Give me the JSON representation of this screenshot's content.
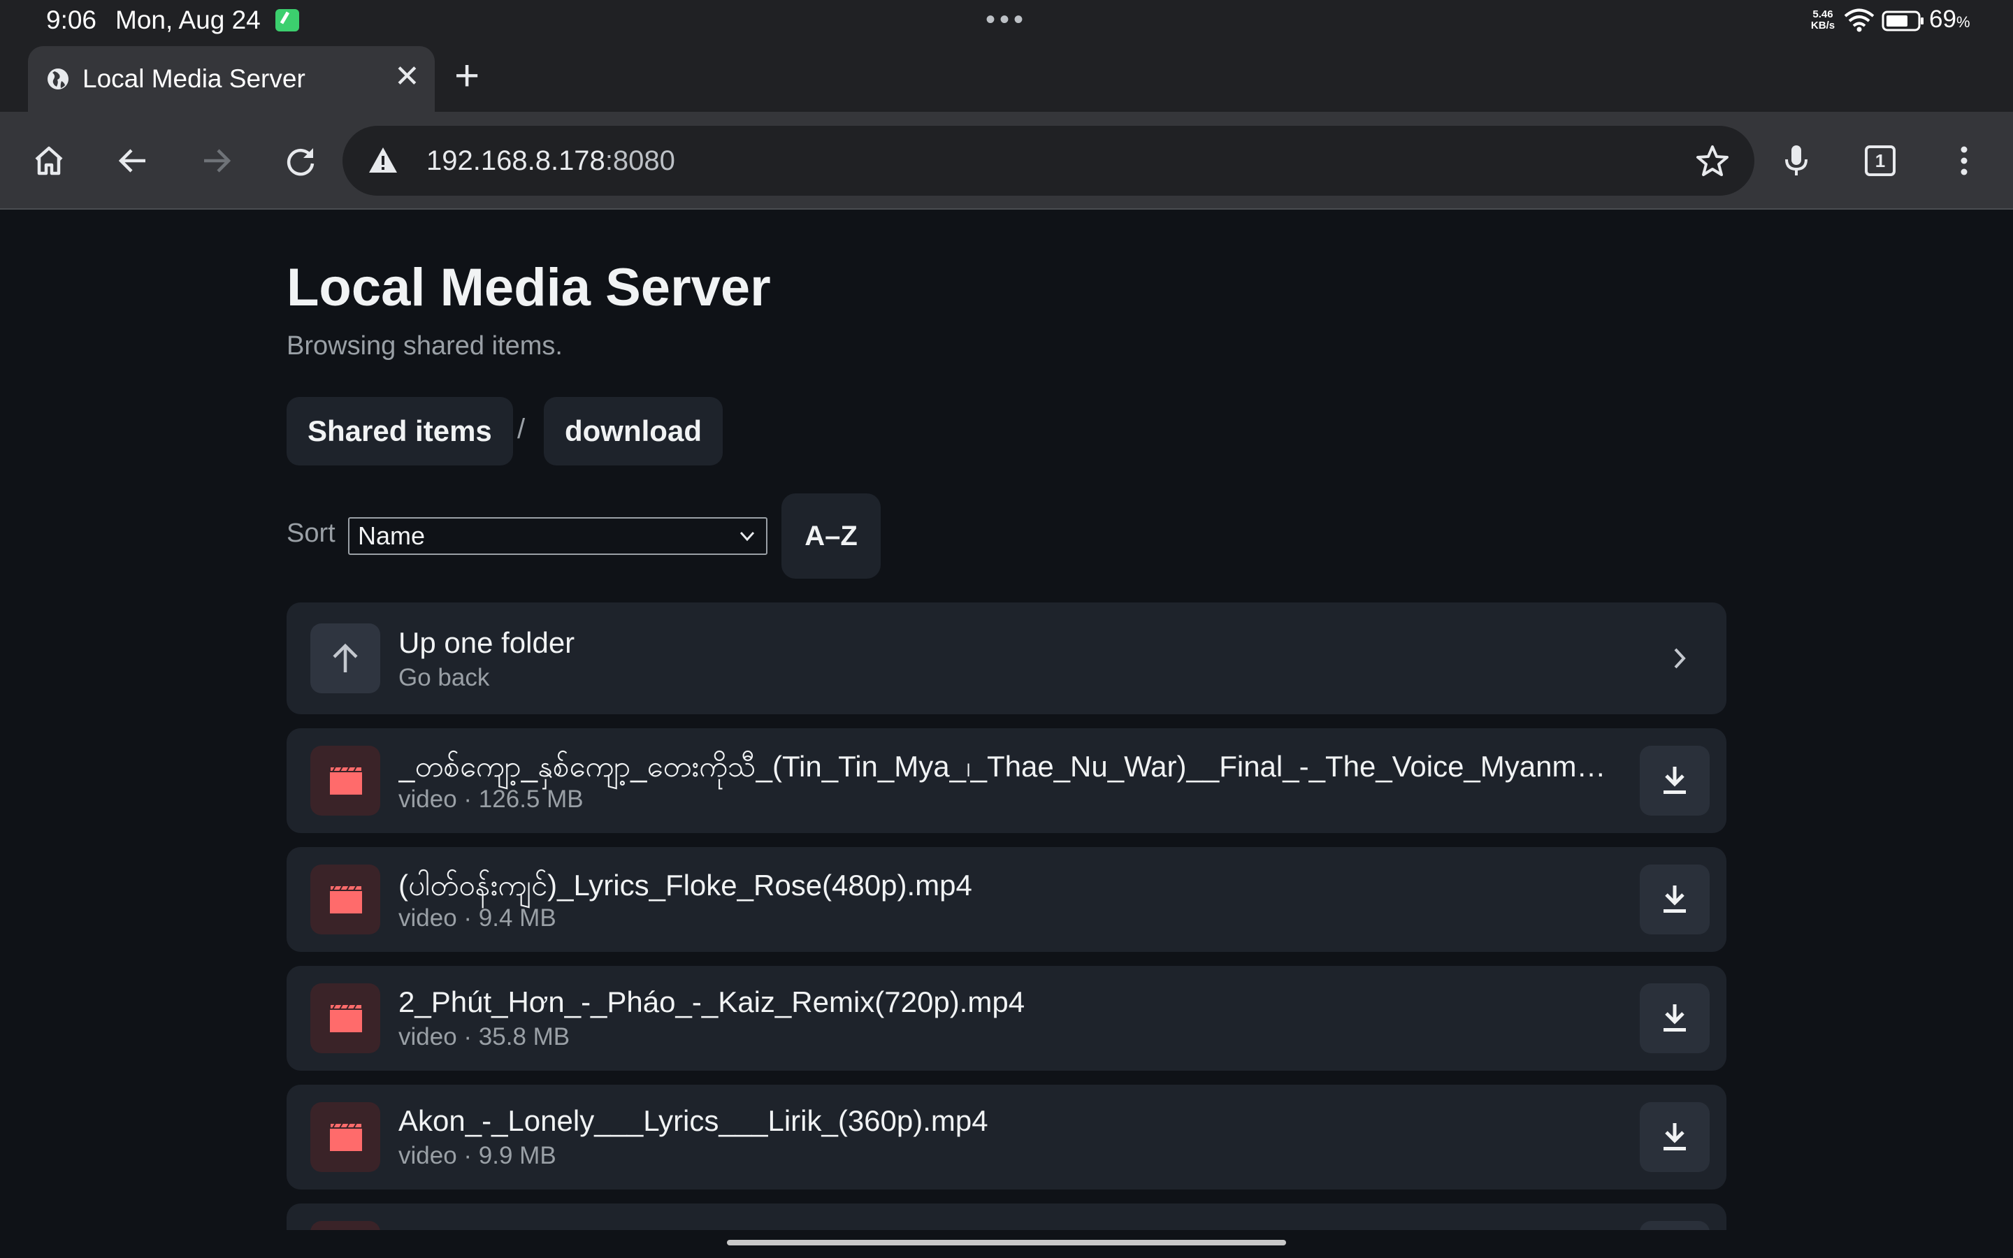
{
  "status_bar": {
    "time": "9:06",
    "date": "Mon, Aug 24",
    "network_speed_value": "5.46",
    "network_speed_unit": "KB/s",
    "battery_percent": "69",
    "battery_unit": "%"
  },
  "browser": {
    "tab_title": "Local Media Server",
    "tab_close": "✕",
    "new_tab": "+",
    "url_host": "192.168.8.178",
    "url_port": ":8080",
    "tab_count": "1"
  },
  "page": {
    "title": "Local Media Server",
    "subtitle": "Browsing shared items.",
    "breadcrumb": [
      {
        "label": "Shared items"
      },
      {
        "label": "download"
      }
    ],
    "breadcrumb_separator": "/",
    "sort": {
      "label": "Sort",
      "selected": "Name",
      "direction": "A–Z"
    },
    "up_folder": {
      "title": "Up one folder",
      "subtitle": "Go back"
    },
    "files": [
      {
        "name": "_တစ်ကျော့_နှစ်ကျော့_တေးကိုသီ_(Tin_Tin_Mya_၊_Thae_Nu_War)__Final_-_The_Voice_Myanmar_…",
        "type": "video",
        "size": "126.5 MB"
      },
      {
        "name": "(ပါတ်ဝန်းကျင်)_Lyrics_Floke_Rose(480p).mp4",
        "type": "video",
        "size": "9.4 MB"
      },
      {
        "name": "2_Phút_Hơn_-_Pháo_-_Kaiz_Remix(720p).mp4",
        "type": "video",
        "size": "35.8 MB"
      },
      {
        "name": "Akon_-_Lonely___Lyrics___Lirik_(360p).mp4",
        "type": "video",
        "size": "9.9 MB"
      }
    ],
    "meta_separator": "·"
  },
  "colors": {
    "accent_video": "#ff6b6b",
    "video_thumb_bg": "#3a2328",
    "card_bg": "#1e232b",
    "page_bg": "#0f1217"
  },
  "icons": {
    "home": "home-icon",
    "back": "arrow-left-icon",
    "forward": "arrow-right-icon",
    "reload": "reload-icon",
    "insecure": "warning-icon",
    "bookmark": "star-icon",
    "mic": "microphone-icon",
    "tabs": "tab-switcher-icon",
    "menu": "more-vert-icon",
    "up": "arrow-up-icon",
    "video": "clapperboard-icon",
    "download": "download-icon",
    "chevron": "chevron-right-icon"
  }
}
